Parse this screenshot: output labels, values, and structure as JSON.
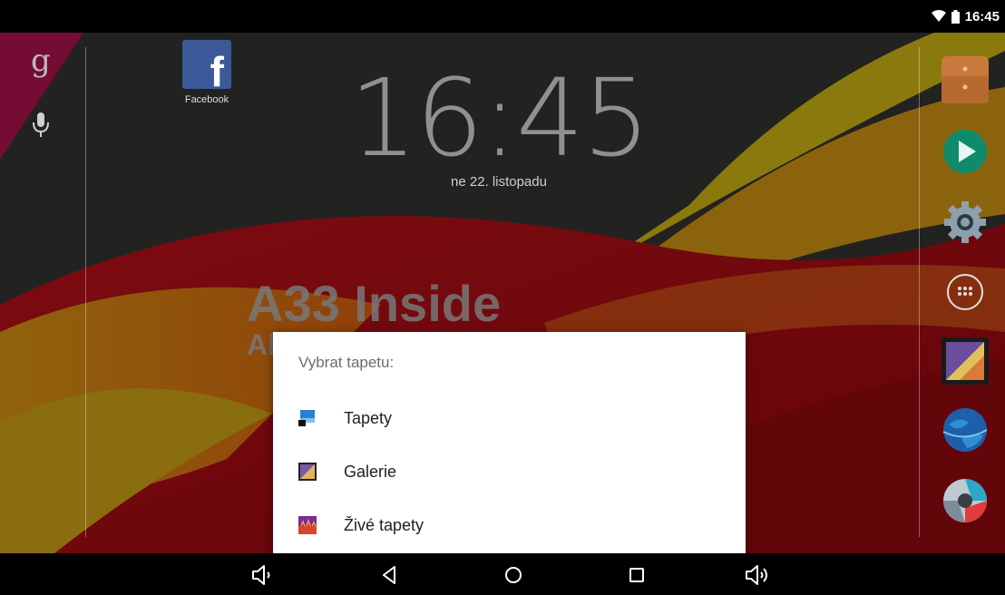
{
  "status_bar": {
    "time": "16:45",
    "icons": [
      "wifi-icon",
      "battery-icon"
    ]
  },
  "home": {
    "left_rail": {
      "icons": [
        "google-search-icon",
        "mic-icon"
      ]
    },
    "apps": [
      {
        "name": "facebook",
        "label": "Facebook"
      }
    ],
    "clock": {
      "time": "16:45",
      "date": "ne 22. listopadu"
    },
    "wallpaper_text": {
      "line1": "A33 Inside",
      "line2": "Al"
    },
    "dock": [
      "store-app-icon",
      "play-store-icon",
      "settings-icon",
      "app-drawer-icon",
      "gallery-icon",
      "browser-icon",
      "camera-icon"
    ]
  },
  "dialog": {
    "title": "Vybrat tapetu:",
    "options": [
      {
        "label": "Tapety",
        "icon": "wallpapers-icon"
      },
      {
        "label": "Galerie",
        "icon": "gallery-icon"
      },
      {
        "label": "Živé tapety",
        "icon": "live-wallpapers-icon"
      }
    ]
  },
  "nav_bar": {
    "buttons": [
      "volume-down-icon",
      "back-icon",
      "home-icon",
      "recents-icon",
      "volume-up-icon"
    ]
  },
  "colors": {
    "dialog_bg": "#ffffff",
    "facebook": "#3b5998",
    "wallpaper_red": "#c40f16",
    "wallpaper_orange": "#f39a12",
    "wallpaper_yellow": "#e9cd12"
  }
}
